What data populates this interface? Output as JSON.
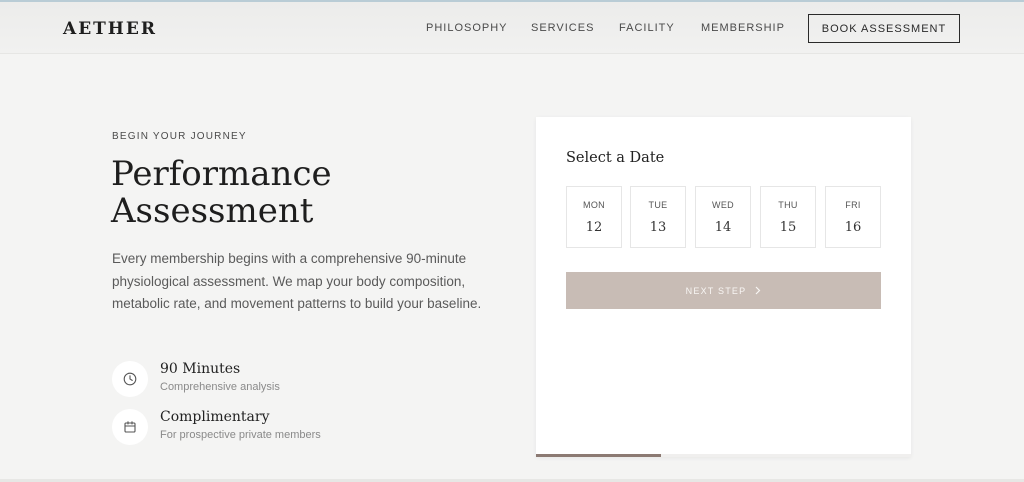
{
  "header": {
    "logo": "AETHER",
    "nav": [
      "PHILOSOPHY",
      "SERVICES",
      "FACILITY",
      "MEMBERSHIP"
    ],
    "book_label": "BOOK ASSESSMENT"
  },
  "hero": {
    "eyebrow": "BEGIN YOUR JOURNEY",
    "title": "Performance Assessment",
    "intro": "Every membership begins with a comprehensive 90-minute physiological assessment. We map your body composition, metabolic rate, and movement patterns to build your baseline.",
    "features": [
      {
        "icon": "clock-icon",
        "title": "90 Minutes",
        "subtitle": "Comprehensive analysis"
      },
      {
        "icon": "calendar-icon",
        "title": "Complimentary",
        "subtitle": "For prospective private members"
      }
    ]
  },
  "booking": {
    "title": "Select a Date",
    "days": [
      {
        "name": "MON",
        "date": "12"
      },
      {
        "name": "TUE",
        "date": "13"
      },
      {
        "name": "WED",
        "date": "14"
      },
      {
        "name": "THU",
        "date": "15"
      },
      {
        "name": "FRI",
        "date": "16"
      }
    ],
    "next_label": "NEXT STEP",
    "next_icon": "chevron-right-icon",
    "progress": 0.333
  },
  "colors": {
    "background": "#f4f4f3",
    "button_muted": "#c8bcb5",
    "progress": "#8c7a73"
  }
}
